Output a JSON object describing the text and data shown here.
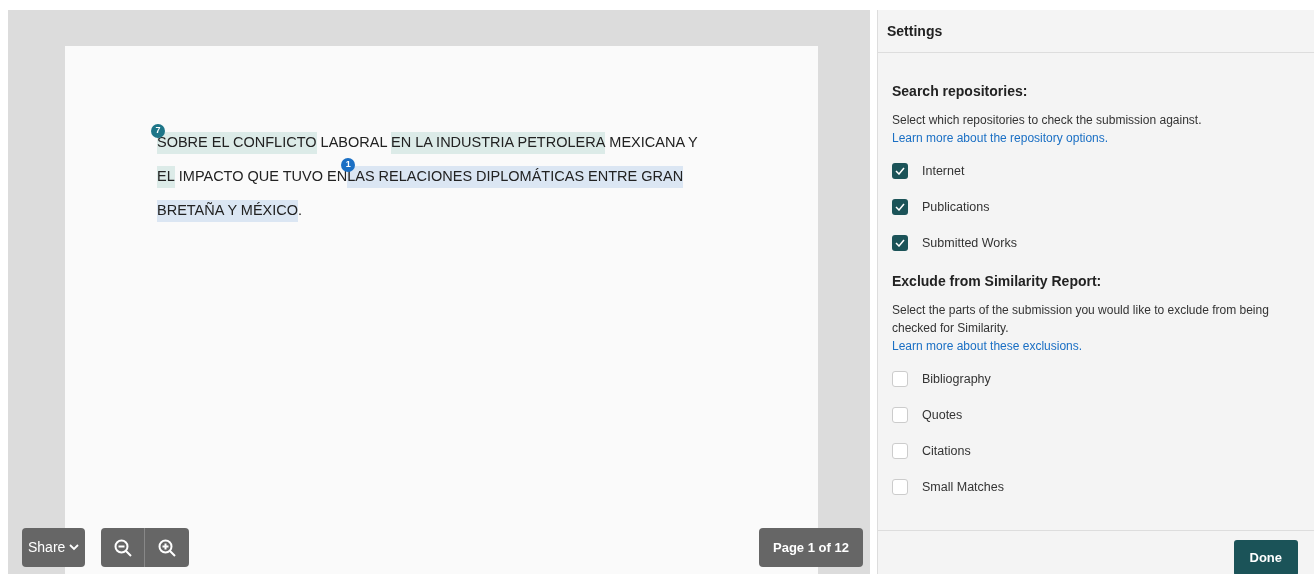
{
  "document": {
    "lines": [
      [
        {
          "text": "SOBRE EL CONFLICTO",
          "color": "#dcebe8",
          "marker": {
            "text": "7",
            "color": "#1d7588"
          }
        },
        {
          "text": " LABORAL "
        },
        {
          "text": "EN LA INDUSTRIA PETROLERA",
          "color": "#dcebe8"
        },
        {
          "text": " MEXICANA Y"
        }
      ],
      [
        {
          "text": "EL",
          "color": "#dcebe8"
        },
        {
          "text": " IMPACTO QUE TUVO EN"
        },
        {
          "text": "LAS RELACIONES DIPLOMÁTICAS ENTRE GRAN",
          "color": "#dbe6f3",
          "marker": {
            "text": "1",
            "color": "#1a6fc4"
          }
        }
      ],
      [
        {
          "text": "BRETAÑA Y MÉXICO",
          "color": "#dbe6f3"
        },
        {
          "text": "."
        }
      ]
    ]
  },
  "toolbar": {
    "share": "Share",
    "page_indicator": "Page 1 of 12"
  },
  "settings": {
    "title": "Settings",
    "sections": [
      {
        "heading": "Search repositories:",
        "description": "Select which repositories to check the submission against.",
        "link": "Learn more about the repository options.",
        "options": [
          {
            "label": "Internet",
            "checked": true
          },
          {
            "label": "Publications",
            "checked": true
          },
          {
            "label": "Submitted Works",
            "checked": true
          }
        ]
      },
      {
        "heading": "Exclude from Similarity Report:",
        "description": "Select the parts of the submission you would like to exclude from being checked for Similarity.",
        "link": "Learn more about these exclusions.",
        "options": [
          {
            "label": "Bibliography",
            "checked": false
          },
          {
            "label": "Quotes",
            "checked": false
          },
          {
            "label": "Citations",
            "checked": false
          },
          {
            "label": "Small Matches",
            "checked": false
          }
        ]
      }
    ],
    "done": "Done"
  }
}
